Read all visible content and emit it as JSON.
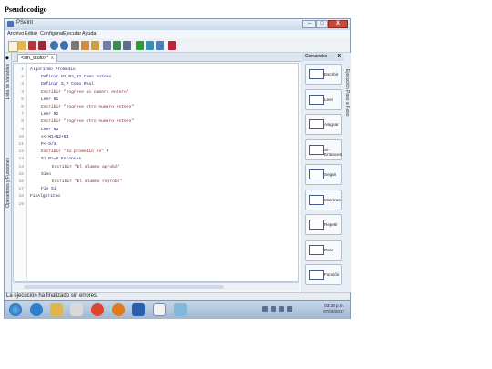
{
  "caption": "Pseudocodigo",
  "window": {
    "title": "PSeInt",
    "min": "–",
    "max": "□",
    "close": "X"
  },
  "menu": [
    "Archivo",
    "Editar",
    "Configurar",
    "Ejecutar",
    "Ayuda"
  ],
  "left_tabs": {
    "vars": "Lista de Variables",
    "ops": "Operadores y Funciones"
  },
  "right_tab": "Ejecución Paso a Paso",
  "editor": {
    "tab_label": "<sin_titulo>*",
    "tab_close": "X",
    "lines": [
      {
        "n": "1",
        "text": "Algoritmo Promedio",
        "indent": 0
      },
      {
        "n": "2",
        "text": "Definir N1,N2,N3 Como Entero",
        "indent": 1
      },
      {
        "n": "3",
        "text": "Definir S,P Como Real",
        "indent": 1
      },
      {
        "n": "4",
        "text": "Escribir \"Ingrese un numero entero\"",
        "indent": 1
      },
      {
        "n": "5",
        "text": "Leer N1",
        "indent": 1
      },
      {
        "n": "6",
        "text": "Escribir \"Ingrese otro numero entero\"",
        "indent": 1
      },
      {
        "n": "7",
        "text": "Leer N2",
        "indent": 1
      },
      {
        "n": "8",
        "text": "Escribir \"Ingrese otro numero entero\"",
        "indent": 1
      },
      {
        "n": "9",
        "text": "Leer N3",
        "indent": 1
      },
      {
        "n": "10",
        "text": "s<-N1+N2+N3",
        "indent": 1
      },
      {
        "n": "11",
        "text": "P<-S/3",
        "indent": 1
      },
      {
        "n": "12",
        "text": "Escribir \"Su promedio es\" P",
        "indent": 1
      },
      {
        "n": "13",
        "text": "Si P>=6 Entonces",
        "indent": 1
      },
      {
        "n": "14",
        "text": "Escribir \"El alumno aprobó\"",
        "indent": 2
      },
      {
        "n": "15",
        "text": "Sino",
        "indent": 1
      },
      {
        "n": "16",
        "text": "Escribir \"El alumno reprobó\"",
        "indent": 2
      },
      {
        "n": "17",
        "text": "Fin Si",
        "indent": 1
      },
      {
        "n": "18",
        "text": "FinAlgoritmo",
        "indent": 0
      },
      {
        "n": "19",
        "text": "",
        "indent": 0
      }
    ]
  },
  "commands": {
    "title": "Comandos",
    "close": "X",
    "items": [
      "Escribir",
      "Leer",
      "Asignar",
      "Si-Entonces",
      "Según",
      "Mientras",
      "Repetir",
      "Para",
      "Función"
    ]
  },
  "status": "La ejecución ha finalizado sin errores.",
  "clock": {
    "time": "03:38 p.m.",
    "date": "07/05/2017"
  }
}
